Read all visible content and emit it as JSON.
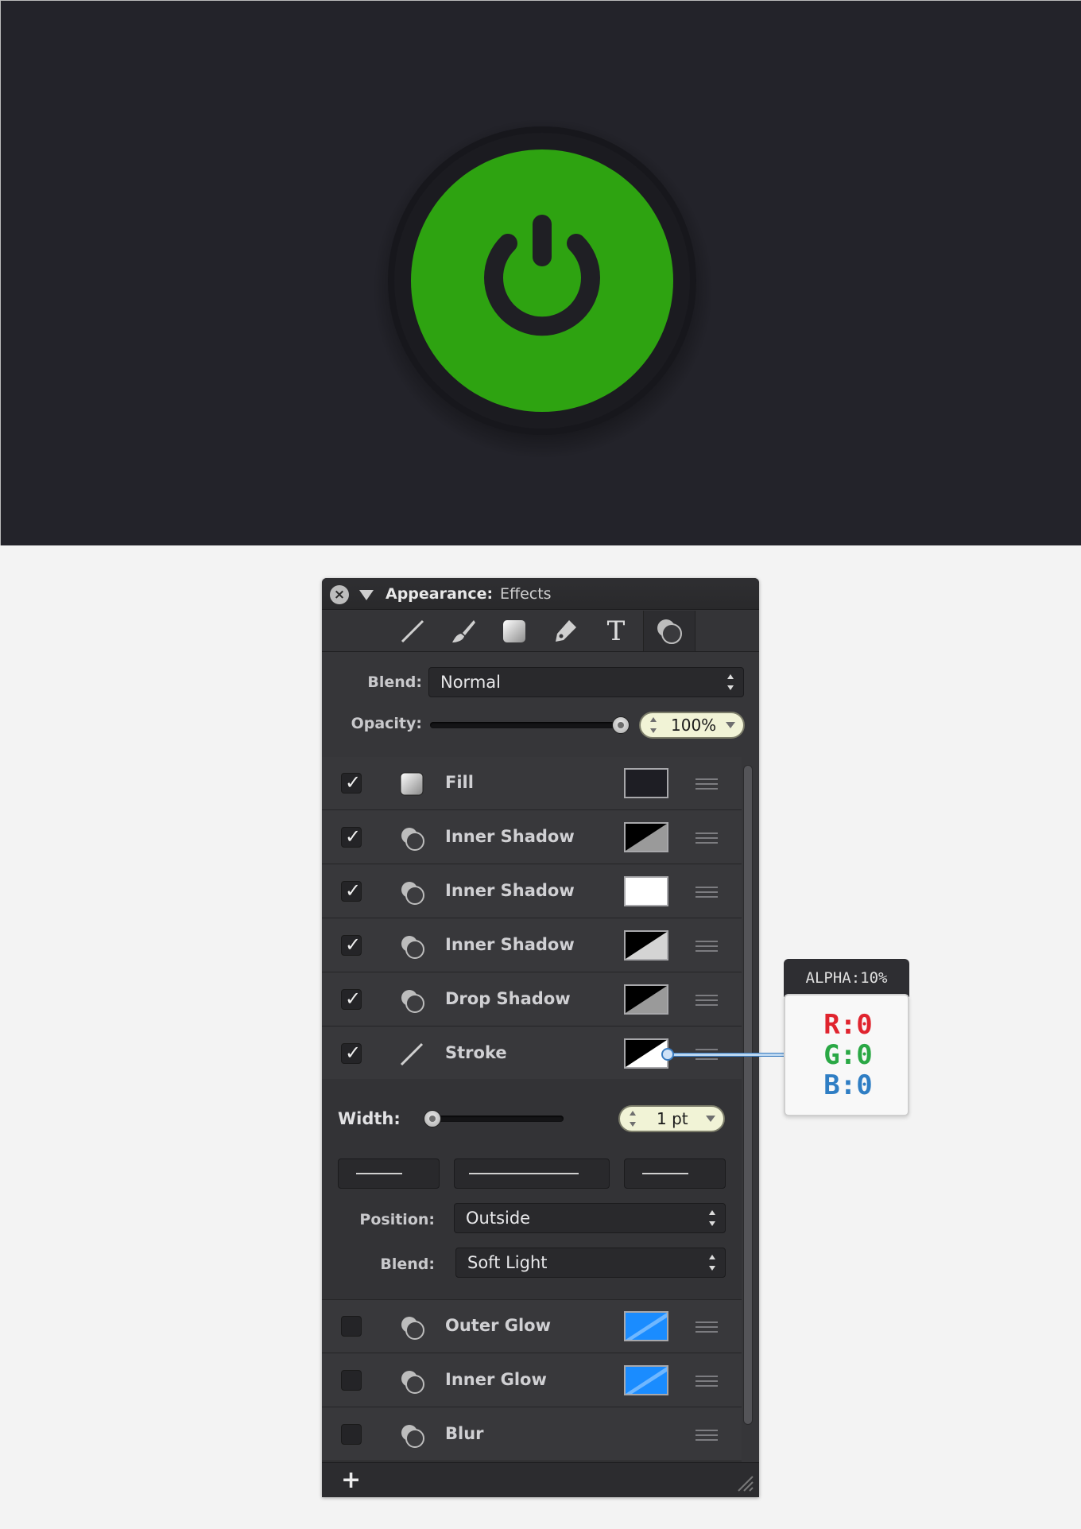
{
  "panel": {
    "title_strong": "Appearance:",
    "title_light": "Effects",
    "tools": [
      "line-tool-icon",
      "brush-tool-icon",
      "fill-tool-icon",
      "pen-tool-icon",
      "text-tool-icon",
      "effects-tool-icon"
    ],
    "text_tool_glyph": "T",
    "blend_label": "Blend:",
    "blend_value": "Normal",
    "opacity_label": "Opacity:",
    "opacity_value": "100%",
    "opacity_level": 1.0
  },
  "effects": [
    {
      "label": "Fill",
      "checked": true,
      "check_glyph": "✓",
      "icon": "fill-swatch-icon",
      "swatch": "dark"
    },
    {
      "label": "Inner Shadow",
      "checked": true,
      "check_glyph": "✓",
      "icon": "shadow-icon",
      "swatch": "black-gray"
    },
    {
      "label": "Inner Shadow",
      "checked": true,
      "check_glyph": "✓",
      "icon": "shadow-icon",
      "swatch": "white"
    },
    {
      "label": "Inner Shadow",
      "checked": true,
      "check_glyph": "✓",
      "icon": "shadow-icon",
      "swatch": "black-lightgray"
    },
    {
      "label": "Drop Shadow",
      "checked": true,
      "check_glyph": "✓",
      "icon": "shadow-icon",
      "swatch": "black-gray"
    },
    {
      "label": "Stroke",
      "checked": true,
      "check_glyph": "✓",
      "icon": "stroke-line-icon",
      "swatch": "black-white"
    }
  ],
  "stroke": {
    "width_label": "Width:",
    "width_value": "1 pt",
    "width_level": 0.0,
    "position_label": "Position:",
    "position_value": "Outside",
    "blend_label": "Blend:",
    "blend_value": "Soft Light"
  },
  "disabled_effects": [
    {
      "label": "Outer Glow",
      "checked": false,
      "icon": "shadow-icon",
      "swatch": "blue"
    },
    {
      "label": "Inner Glow",
      "checked": false,
      "icon": "shadow-icon",
      "swatch": "blue"
    },
    {
      "label": "Blur",
      "checked": false,
      "icon": "shadow-icon",
      "swatch": "none"
    }
  ],
  "footer": {
    "add_glyph": "+"
  },
  "callout": {
    "alpha": "ALPHA:10%",
    "r": "R:0",
    "g": "G:0",
    "b": "B:0"
  },
  "colors": {
    "canvas_bg": "#23232a",
    "button_green": "#2ea311",
    "button_ring": "#17171c",
    "power_icon": "#1f1f24",
    "blue_swatch": "#1a8cff",
    "callout_r": "#e0242e",
    "callout_g": "#2aa845",
    "callout_b": "#2f7ec4"
  }
}
